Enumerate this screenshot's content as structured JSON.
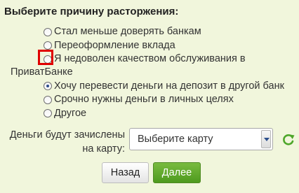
{
  "form": {
    "title": "Выберите причину расторжения:",
    "reasons": [
      {
        "label": "Стал меньше доверять банкам",
        "selected": false
      },
      {
        "label": "Переоформление вклада",
        "selected": false
      },
      {
        "label_line1": "Я недоволен качеством обслуживания в",
        "label_line2": "ПриватБанке",
        "selected": false,
        "highlighted": true
      },
      {
        "label": "Хочу перевести деньги на депозит в другой банк",
        "selected": true
      },
      {
        "label": "Срочно нужны деньги в личных целях",
        "selected": false
      },
      {
        "label": "Другое",
        "selected": false
      }
    ],
    "card_label_line1": "Деньги будут зачислены",
    "card_label_line2": "на карту:",
    "card_select": {
      "selected": "Выберите карту"
    },
    "back_label": "Назад",
    "next_label": "Далее",
    "refresh_icon": "refresh-icon"
  },
  "colors": {
    "background": "#f1f6dc",
    "accent_green": "#5aa82a",
    "highlight": "#e00000"
  }
}
